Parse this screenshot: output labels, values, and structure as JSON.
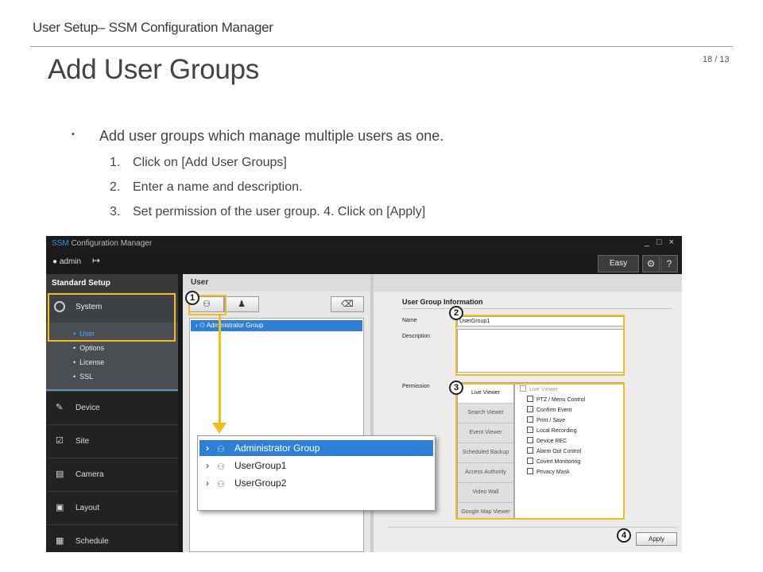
{
  "slide": {
    "header": "User Setup– SSM Configuration Manager",
    "title": "Add User Groups",
    "page": "18 / 13",
    "bullet": "Add user groups which manage multiple users as one.",
    "steps": [
      {
        "n": "1.",
        "text": "Click on [Add User Groups]"
      },
      {
        "n": "2.",
        "text": "Enter a name and description."
      },
      {
        "n": "3.",
        "text": "Set permission of the user group.  4. Click on [Apply]"
      }
    ]
  },
  "app": {
    "brand": "SSM",
    "title_rest": " Configuration Manager",
    "window_controls": "_ □ ×",
    "user": "admin",
    "easy_guide": "Easy Guide",
    "help": "?",
    "sidebar": {
      "title": "Standard Setup",
      "system": "System",
      "sub_items": [
        "User",
        "Options",
        "License",
        "SSL"
      ],
      "nav_items": [
        "Device",
        "Site",
        "Camera",
        "Layout",
        "Schedule"
      ]
    },
    "user_panel": {
      "title": "User",
      "tree_selected": "Administrator Group"
    },
    "info": {
      "title": "User Group Information",
      "name_label": "Name",
      "name_value": "UserGroup1",
      "desc_label": "Description",
      "perm_label": "Permission",
      "tabs": [
        "Live Viewer",
        "Search Viewer",
        "Event Viewer",
        "Scheduled Backup",
        "Access Authority",
        "Video Wall",
        "Google Map Viewer"
      ],
      "perm_header": "Live Viewer",
      "perms": [
        "PTZ / Menu Control",
        "Confirm Event",
        "Print / Save",
        "Local Recording",
        "Device REC",
        "Alarm Out Control",
        "Covert Monitoring",
        "Privacy Mask"
      ],
      "apply": "Apply"
    }
  },
  "callouts": [
    "1",
    "2",
    "3",
    "4"
  ],
  "zoom_tree": [
    "Administrator Group",
    "UserGroup1",
    "UserGroup2"
  ],
  "colors": {
    "highlight": "#f5bd1c",
    "selection": "#2d7fd6",
    "brand": "#3a8ee6"
  }
}
